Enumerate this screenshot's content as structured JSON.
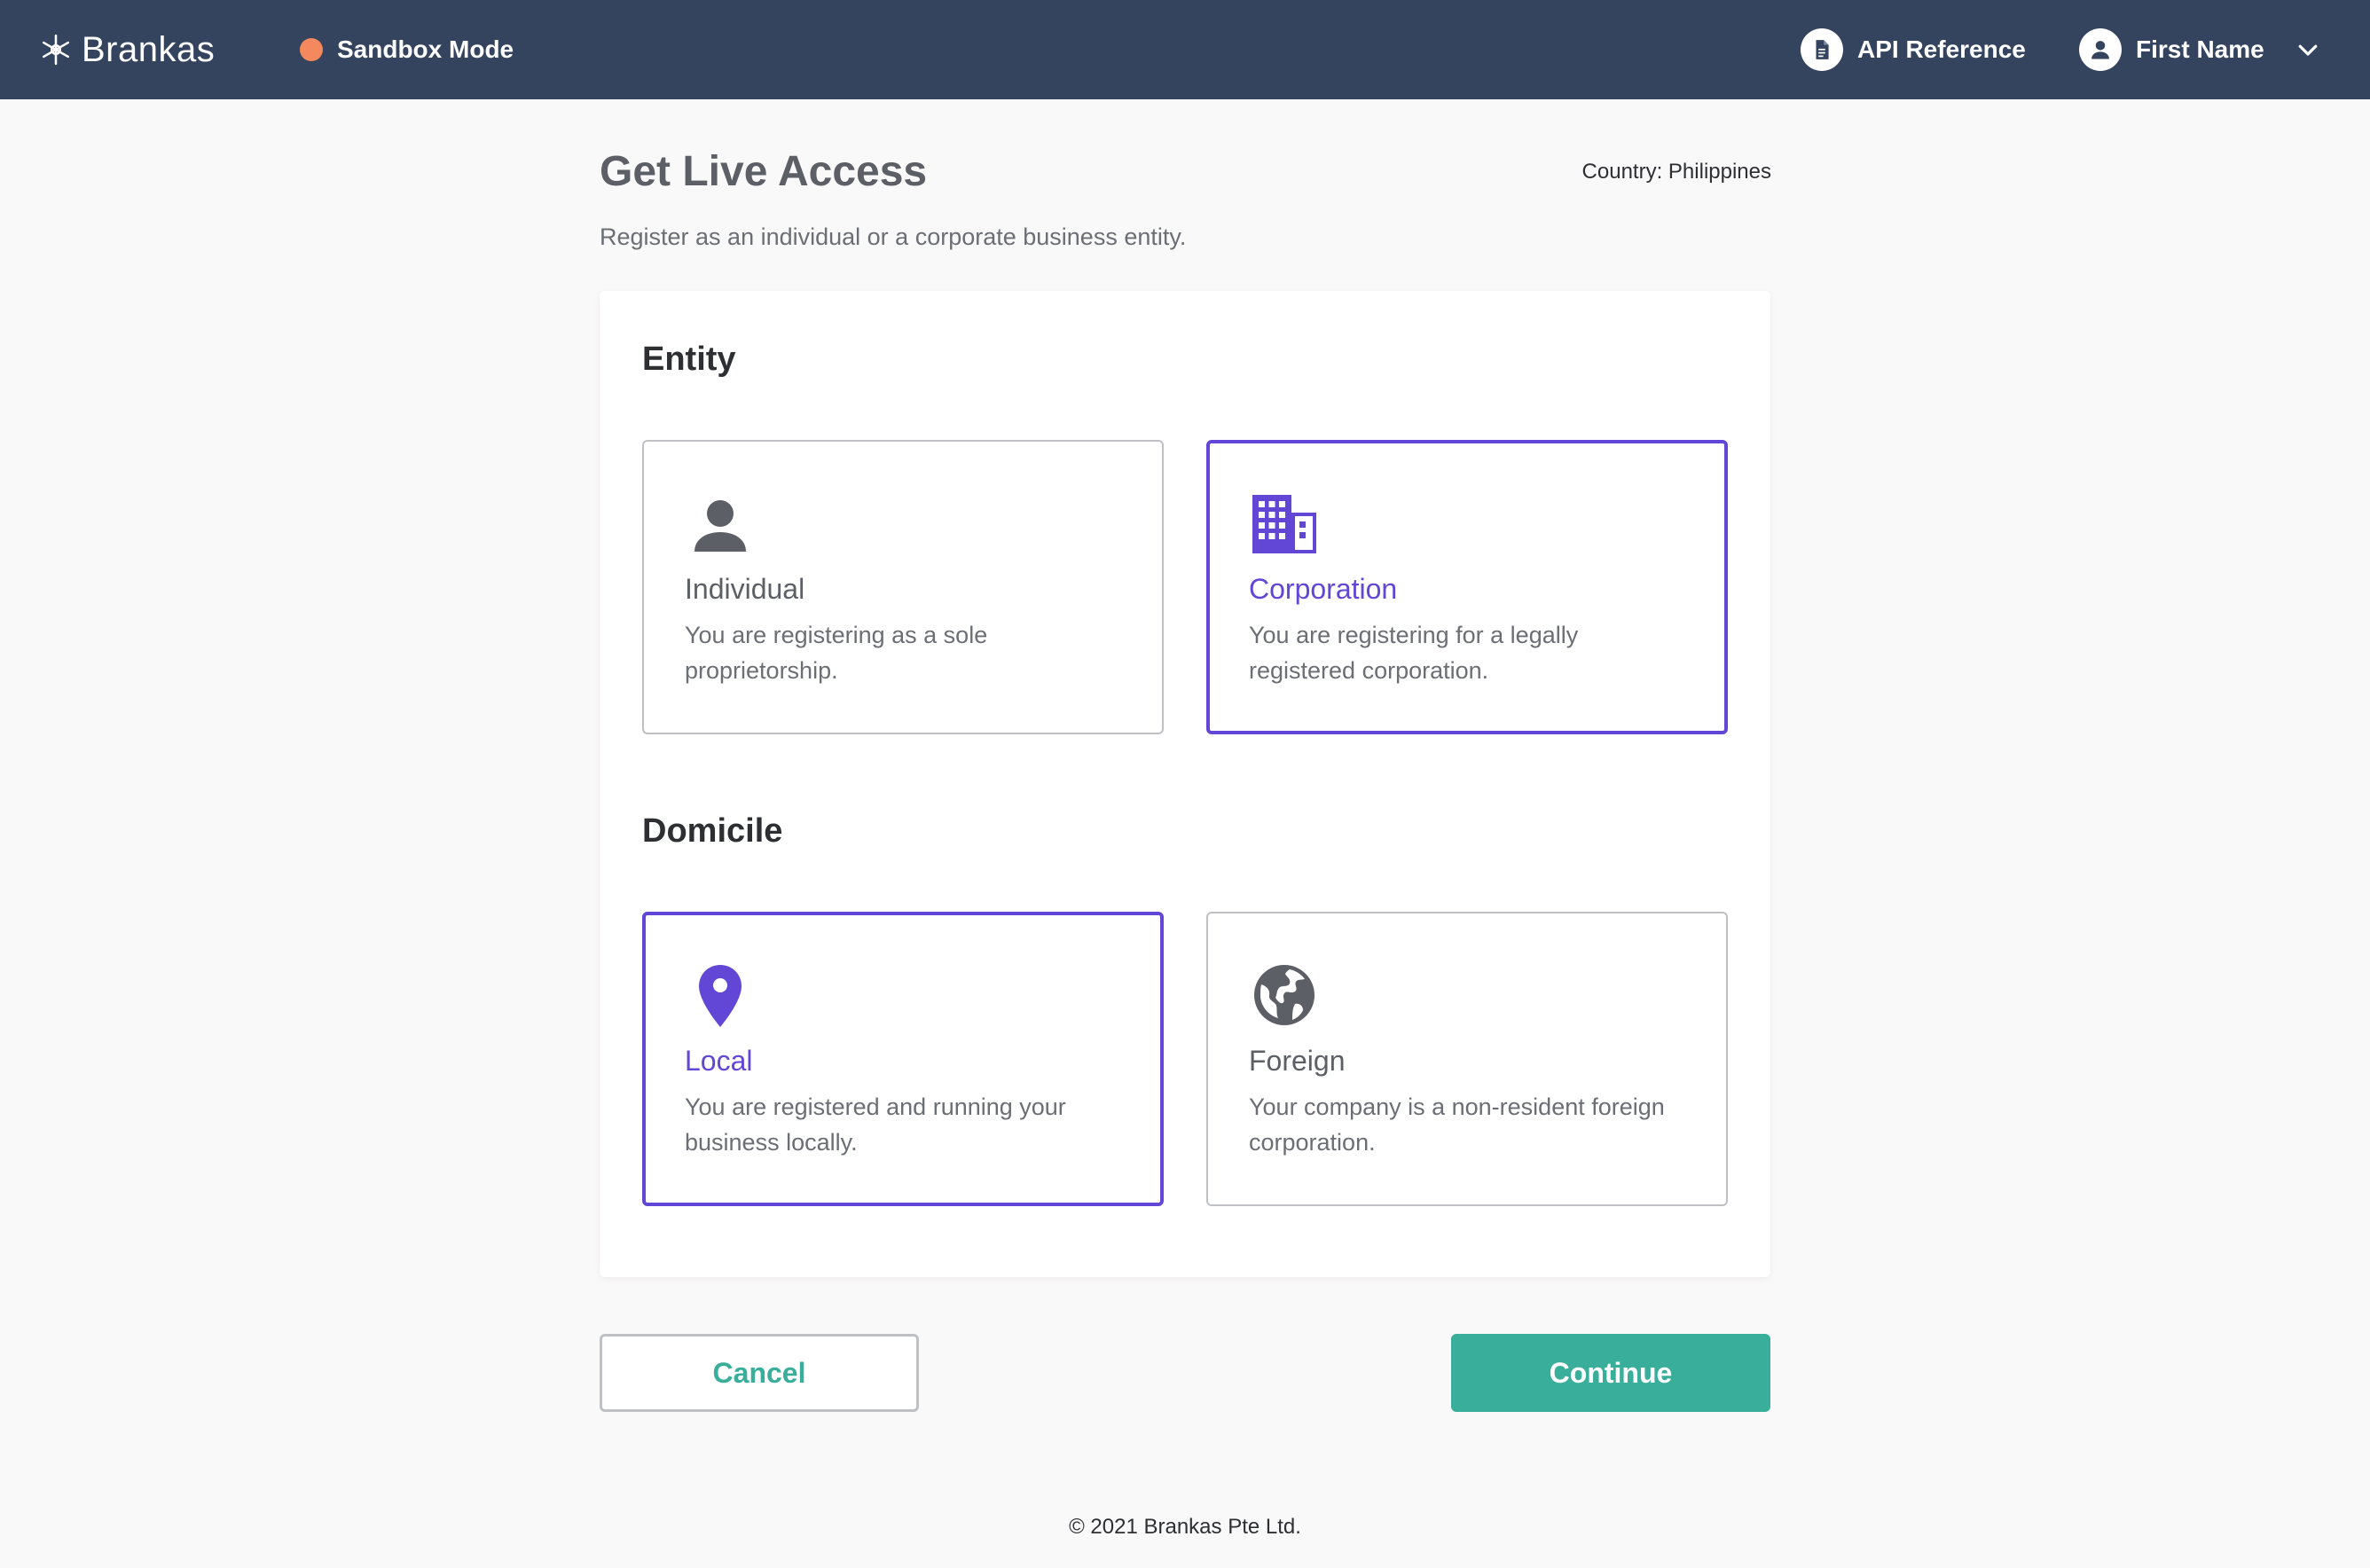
{
  "header": {
    "brand": "Brankas",
    "brand_icon": "snowflake-logo-icon",
    "mode_label": "Sandbox Mode",
    "mode_color": "#f4895e",
    "api_reference_label": "API Reference",
    "user_name": "First Name"
  },
  "page": {
    "title": "Get Live Access",
    "country": "Country: Philippines",
    "subtitle": "Register as an individual or a corporate business entity."
  },
  "entity": {
    "title": "Entity",
    "options": [
      {
        "icon": "person-icon",
        "label": "Individual",
        "description": "You are registering as a sole proprietorship.",
        "selected": false
      },
      {
        "icon": "building-icon",
        "label": "Corporation",
        "description": "You are registering for a legally registered corporation.",
        "selected": true
      }
    ]
  },
  "domicile": {
    "title": "Domicile",
    "options": [
      {
        "icon": "location-pin-icon",
        "label": "Local",
        "description": "You are registered and running your business locally.",
        "selected": true
      },
      {
        "icon": "globe-icon",
        "label": "Foreign",
        "description": "Your company is a non-resident foreign corporation.",
        "selected": false
      }
    ]
  },
  "actions": {
    "cancel_label": "Cancel",
    "continue_label": "Continue"
  },
  "colors": {
    "nav_bg": "#34435e",
    "accent": "#6247d6",
    "primary": "#39ae9b"
  },
  "footer": {
    "copyright": "© 2021 Brankas Pte Ltd."
  }
}
